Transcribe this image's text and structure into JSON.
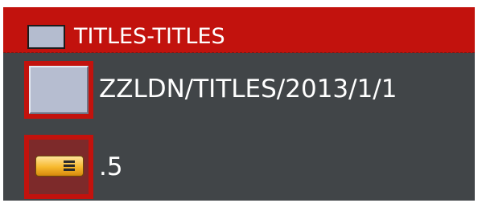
{
  "header": {
    "title": "TITLES-TITLES",
    "color": "#c2120d",
    "swatch_color": "#b4bccf"
  },
  "rows": [
    {
      "label": "ZZLDN/TITLES/2013/1/1",
      "icon": "clip-color-swatch-icon",
      "swatch_color": "#b6bdd0"
    },
    {
      "label": ".5",
      "icon": "segment-icon"
    }
  ],
  "colors": {
    "background": "#414548",
    "selection": "#c2120d",
    "text": "#ffffff",
    "segment": "#f7b92e"
  }
}
